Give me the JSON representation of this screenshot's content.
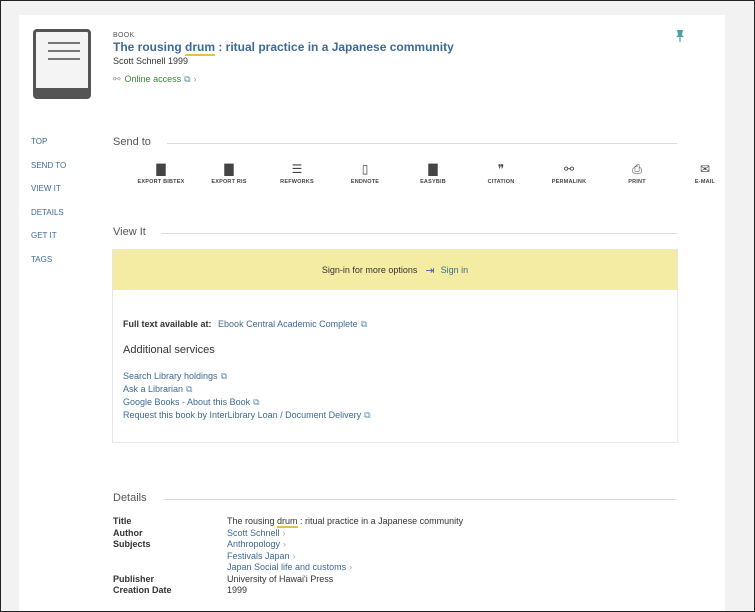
{
  "record": {
    "type_label": "BOOK",
    "title_pre": "The rousing ",
    "title_mark": "drum",
    "title_post": " : ritual practice in a Japanese community",
    "byline": "Scott Schnell 1999",
    "online_access": "Online access",
    "icons": {
      "thumb": "book-thumbnail-icon",
      "pin": "pin-icon",
      "link": "link-icon"
    }
  },
  "nav": [
    "TOP",
    "SEND TO",
    "VIEW IT",
    "DETAILS",
    "GET IT",
    "TAGS"
  ],
  "send_to": {
    "heading": "Send to",
    "actions": [
      {
        "label": "EXPORT BIBTEX",
        "icon": "file-icon",
        "glyph": "▇"
      },
      {
        "label": "EXPORT RIS",
        "icon": "file-icon",
        "glyph": "▇"
      },
      {
        "label": "REFWORKS",
        "icon": "document-icon",
        "glyph": "☰"
      },
      {
        "label": "ENDNOTE",
        "icon": "page-icon",
        "glyph": "▯"
      },
      {
        "label": "EASYBIB",
        "icon": "file-icon",
        "glyph": "▇"
      },
      {
        "label": "CITATION",
        "icon": "quote-icon",
        "glyph": "❞"
      },
      {
        "label": "PERMALINK",
        "icon": "link-icon",
        "glyph": "⚯"
      },
      {
        "label": "PRINT",
        "icon": "printer-icon",
        "glyph": "⎙"
      },
      {
        "label": "E-MAIL",
        "icon": "envelope-icon",
        "glyph": "✉"
      }
    ]
  },
  "view_it": {
    "heading": "View It",
    "banner_text": "Sign-in for more options",
    "sign_in": "Sign in",
    "full_text_label": "Full text available at:",
    "full_text_link": "Ebook Central Academic Complete",
    "additional": "Additional services",
    "links": [
      "Search Library holdings",
      "Ask a Librarian",
      "Google Books - About this Book",
      "Request this book by InterLibrary Loan / Document Delivery"
    ]
  },
  "details": {
    "heading": "Details",
    "title_label": "Title",
    "title_pre": "The rousing ",
    "title_mark": "drum",
    "title_post": " : ritual practice in a Japanese community",
    "author_label": "Author",
    "author": "Scott Schnell",
    "subjects_label": "Subjects",
    "subjects": [
      "Anthropology",
      "Festivals Japan",
      "Japan Social life and customs"
    ],
    "publisher_label": "Publisher",
    "publisher": "University of Hawai'i Press",
    "date_label": "Creation Date",
    "date": "1999"
  },
  "colors": {
    "link": "#3d6a94",
    "banner": "#f4eca2",
    "access": "#3a8a3a",
    "pin": "#4aa3a8"
  }
}
